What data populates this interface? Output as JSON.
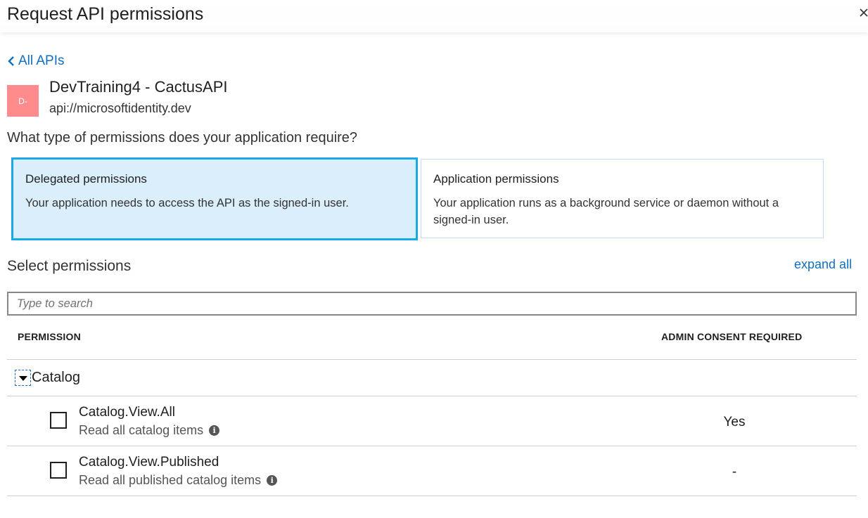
{
  "header": {
    "title": "Request API permissions",
    "close_icon": "close-icon"
  },
  "nav": {
    "back_label": "All APIs",
    "back_icon": "chevron-left-icon"
  },
  "api": {
    "avatar_text": "D-",
    "avatar_color": "#ff8c8c",
    "name": "DevTraining4 - CactusAPI",
    "uri": "api://microsoftidentity.dev"
  },
  "permission_type": {
    "question": "What type of permissions does your application require?",
    "selected": "delegated",
    "options": [
      {
        "key": "delegated",
        "title": "Delegated permissions",
        "description": "Your application needs to access the API as the signed-in user."
      },
      {
        "key": "application",
        "title": "Application permissions",
        "description": "Your application runs as a background service or daemon without a signed-in user."
      }
    ]
  },
  "select_permissions": {
    "heading": "Select permissions",
    "expand_all_label": "expand all",
    "search_placeholder": "Type to search",
    "search_value": ""
  },
  "table": {
    "columns": [
      "PERMISSION",
      "ADMIN CONSENT REQUIRED"
    ],
    "groups": [
      {
        "name": "Catalog",
        "expanded": true,
        "items": [
          {
            "name": "Catalog.View.All",
            "description": "Read all catalog items",
            "admin_consent": "Yes",
            "checked": false
          },
          {
            "name": "Catalog.View.Published",
            "description": "Read all published catalog items",
            "admin_consent": "-",
            "checked": false
          }
        ]
      }
    ]
  },
  "colors": {
    "link": "#106ebe",
    "selected_card_bg": "#dbeefc",
    "selected_card_border": "#1aa9e6",
    "card_border": "#c6dcf5"
  }
}
